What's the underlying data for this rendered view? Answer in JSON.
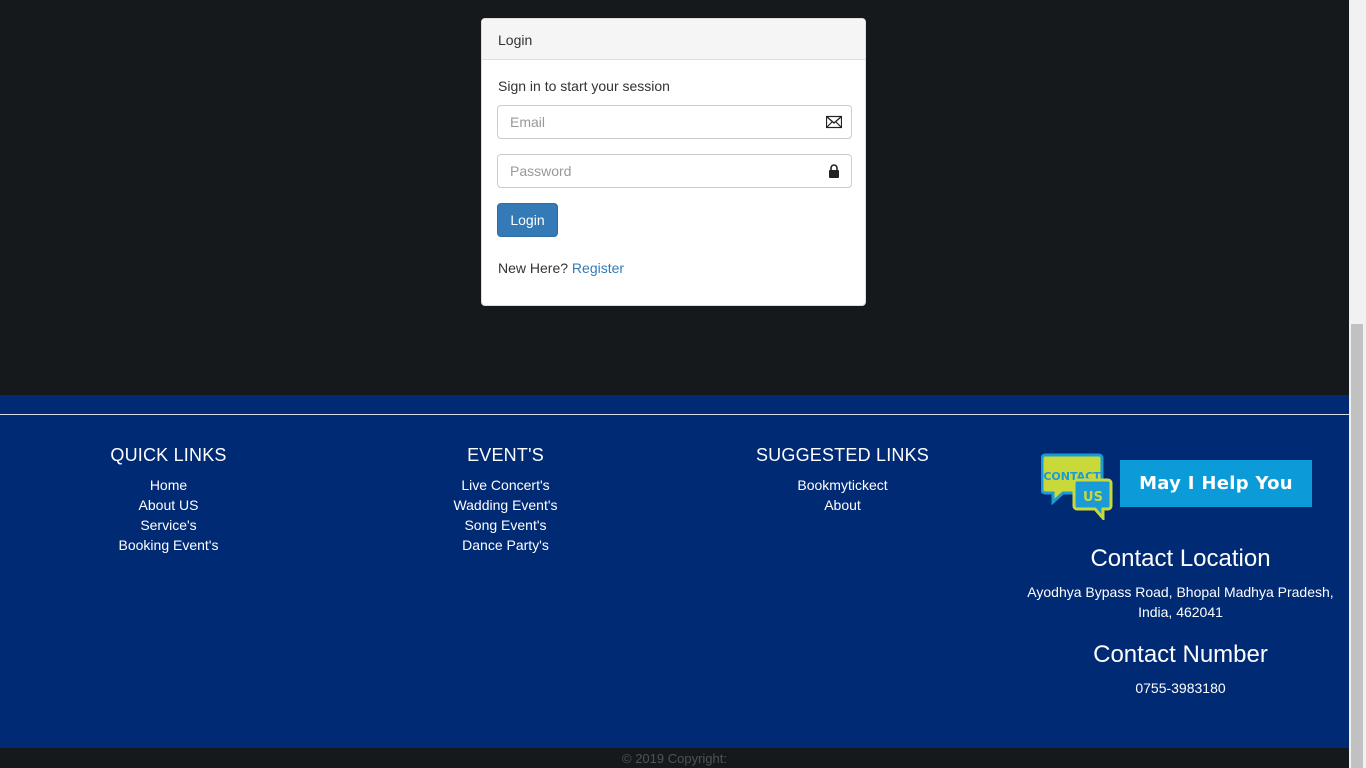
{
  "login": {
    "title": "Login",
    "subtitle": "Sign in to start your session",
    "email_placeholder": "Email",
    "password_placeholder": "Password",
    "submit_label": "Login",
    "new_here": "New Here?",
    "register_label": "Register"
  },
  "footer": {
    "quick_links": {
      "heading": "QUICK LINKS",
      "items": [
        "Home",
        "About US",
        "Service's",
        "Booking Event's"
      ]
    },
    "events": {
      "heading": "EVENT'S",
      "items": [
        "Live Concert's",
        "Wadding Event's",
        "Song Event's",
        "Dance Party's"
      ]
    },
    "suggested": {
      "heading": "SUGGESTED LINKS",
      "items": [
        "Bookmytickect",
        "About"
      ]
    },
    "contact_logo": {
      "line1": "CONTACT",
      "line2": "US"
    },
    "help_label": "May I Help You",
    "location_heading": "Contact Location",
    "location_line1": "Ayodhya Bypass Road, Bhopal Madhya Pradesh,",
    "location_line2": "India, 462041",
    "number_heading": "Contact Number",
    "number": "0755-3983180"
  },
  "copyright": "© 2019 Copyright:",
  "colors": {
    "page_bg": "#16191c",
    "footer_bg": "#002a74",
    "primary_button": "#337ab7",
    "help_button": "#0a9bd8",
    "link": "#337ab7"
  },
  "icons": {
    "email": "envelope-icon",
    "password": "lock-icon"
  }
}
